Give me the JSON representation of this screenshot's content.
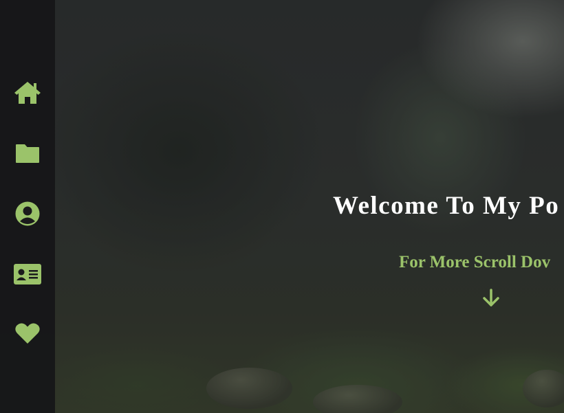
{
  "accent_color": "#9bc36a",
  "sidebar": {
    "items": [
      {
        "icon": "home-icon",
        "target": "home"
      },
      {
        "icon": "folder-icon",
        "target": "portfolio"
      },
      {
        "icon": "user-circle-icon",
        "target": "about"
      },
      {
        "icon": "id-card-icon",
        "target": "contact"
      },
      {
        "icon": "heart-icon",
        "target": "favorites"
      }
    ]
  },
  "hero": {
    "title": "Welcome To My Po",
    "subtitle": "For More Scroll Dov",
    "arrow_icon": "arrow-down-icon"
  }
}
